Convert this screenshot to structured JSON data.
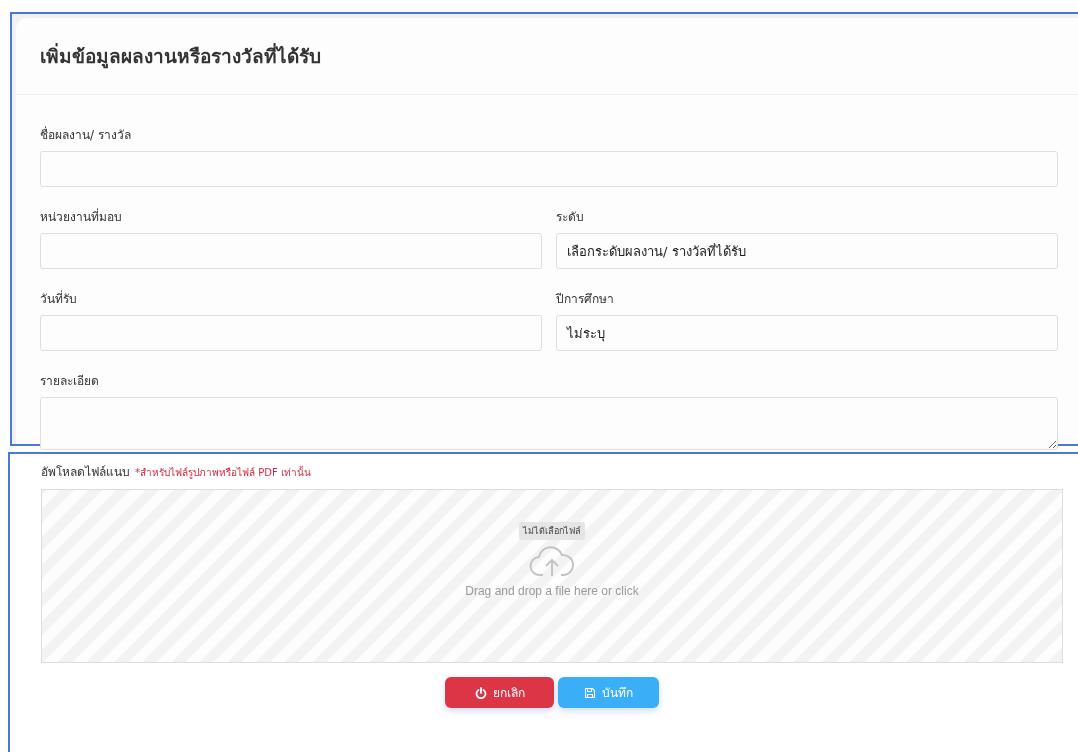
{
  "title": "เพิ่มข้อมูลผลงานหรือรางวัลที่ได้รับ",
  "rows": [
    [
      {
        "kind": "input",
        "label": "ชื่อผลงาน/ รางวัล"
      }
    ],
    [
      {
        "kind": "input",
        "label": "หน่วยงานที่มอบ"
      },
      {
        "kind": "select",
        "label": "ระดับ",
        "value": "เลือกระดับผลงาน/ รางวัลที่ได้รับ"
      }
    ],
    [
      {
        "kind": "input",
        "label": "วันที่รับ"
      },
      {
        "kind": "select",
        "label": "ปีการศึกษา",
        "value": "ไม่ระบุ"
      }
    ],
    [
      {
        "kind": "textarea",
        "label": "รายละเอียด"
      }
    ]
  ],
  "upload": {
    "label": "อัพโหลดไฟล์แนบ",
    "note": "*สำหรับไฟล์รูปภาพหรือไฟล์ PDF เท่านั้น",
    "file_status": "ไม่ได้เลือกไฟล์",
    "hint": "Drag and drop a file here or click"
  },
  "buttons": [
    {
      "kind": "cancel",
      "label": "ยกเลิก"
    },
    {
      "kind": "save",
      "label": "บันทึก"
    }
  ]
}
